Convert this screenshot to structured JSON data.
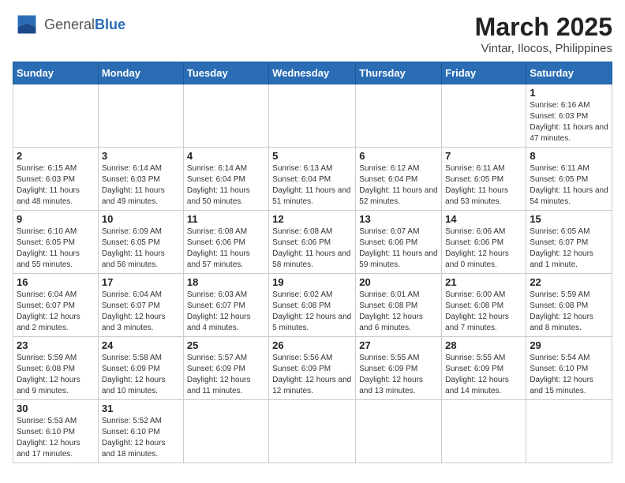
{
  "header": {
    "logo_general": "General",
    "logo_blue": "Blue",
    "month": "March 2025",
    "location": "Vintar, Ilocos, Philippines"
  },
  "weekdays": [
    "Sunday",
    "Monday",
    "Tuesday",
    "Wednesday",
    "Thursday",
    "Friday",
    "Saturday"
  ],
  "weeks": [
    [
      {
        "day": "",
        "info": ""
      },
      {
        "day": "",
        "info": ""
      },
      {
        "day": "",
        "info": ""
      },
      {
        "day": "",
        "info": ""
      },
      {
        "day": "",
        "info": ""
      },
      {
        "day": "",
        "info": ""
      },
      {
        "day": "1",
        "info": "Sunrise: 6:16 AM\nSunset: 6:03 PM\nDaylight: 11 hours and 47 minutes."
      }
    ],
    [
      {
        "day": "2",
        "info": "Sunrise: 6:15 AM\nSunset: 6:03 PM\nDaylight: 11 hours and 48 minutes."
      },
      {
        "day": "3",
        "info": "Sunrise: 6:14 AM\nSunset: 6:03 PM\nDaylight: 11 hours and 49 minutes."
      },
      {
        "day": "4",
        "info": "Sunrise: 6:14 AM\nSunset: 6:04 PM\nDaylight: 11 hours and 50 minutes."
      },
      {
        "day": "5",
        "info": "Sunrise: 6:13 AM\nSunset: 6:04 PM\nDaylight: 11 hours and 51 minutes."
      },
      {
        "day": "6",
        "info": "Sunrise: 6:12 AM\nSunset: 6:04 PM\nDaylight: 11 hours and 52 minutes."
      },
      {
        "day": "7",
        "info": "Sunrise: 6:11 AM\nSunset: 6:05 PM\nDaylight: 11 hours and 53 minutes."
      },
      {
        "day": "8",
        "info": "Sunrise: 6:11 AM\nSunset: 6:05 PM\nDaylight: 11 hours and 54 minutes."
      }
    ],
    [
      {
        "day": "9",
        "info": "Sunrise: 6:10 AM\nSunset: 6:05 PM\nDaylight: 11 hours and 55 minutes."
      },
      {
        "day": "10",
        "info": "Sunrise: 6:09 AM\nSunset: 6:05 PM\nDaylight: 11 hours and 56 minutes."
      },
      {
        "day": "11",
        "info": "Sunrise: 6:08 AM\nSunset: 6:06 PM\nDaylight: 11 hours and 57 minutes."
      },
      {
        "day": "12",
        "info": "Sunrise: 6:08 AM\nSunset: 6:06 PM\nDaylight: 11 hours and 58 minutes."
      },
      {
        "day": "13",
        "info": "Sunrise: 6:07 AM\nSunset: 6:06 PM\nDaylight: 11 hours and 59 minutes."
      },
      {
        "day": "14",
        "info": "Sunrise: 6:06 AM\nSunset: 6:06 PM\nDaylight: 12 hours and 0 minutes."
      },
      {
        "day": "15",
        "info": "Sunrise: 6:05 AM\nSunset: 6:07 PM\nDaylight: 12 hours and 1 minute."
      }
    ],
    [
      {
        "day": "16",
        "info": "Sunrise: 6:04 AM\nSunset: 6:07 PM\nDaylight: 12 hours and 2 minutes."
      },
      {
        "day": "17",
        "info": "Sunrise: 6:04 AM\nSunset: 6:07 PM\nDaylight: 12 hours and 3 minutes."
      },
      {
        "day": "18",
        "info": "Sunrise: 6:03 AM\nSunset: 6:07 PM\nDaylight: 12 hours and 4 minutes."
      },
      {
        "day": "19",
        "info": "Sunrise: 6:02 AM\nSunset: 6:08 PM\nDaylight: 12 hours and 5 minutes."
      },
      {
        "day": "20",
        "info": "Sunrise: 6:01 AM\nSunset: 6:08 PM\nDaylight: 12 hours and 6 minutes."
      },
      {
        "day": "21",
        "info": "Sunrise: 6:00 AM\nSunset: 6:08 PM\nDaylight: 12 hours and 7 minutes."
      },
      {
        "day": "22",
        "info": "Sunrise: 5:59 AM\nSunset: 6:08 PM\nDaylight: 12 hours and 8 minutes."
      }
    ],
    [
      {
        "day": "23",
        "info": "Sunrise: 5:59 AM\nSunset: 6:08 PM\nDaylight: 12 hours and 9 minutes."
      },
      {
        "day": "24",
        "info": "Sunrise: 5:58 AM\nSunset: 6:09 PM\nDaylight: 12 hours and 10 minutes."
      },
      {
        "day": "25",
        "info": "Sunrise: 5:57 AM\nSunset: 6:09 PM\nDaylight: 12 hours and 11 minutes."
      },
      {
        "day": "26",
        "info": "Sunrise: 5:56 AM\nSunset: 6:09 PM\nDaylight: 12 hours and 12 minutes."
      },
      {
        "day": "27",
        "info": "Sunrise: 5:55 AM\nSunset: 6:09 PM\nDaylight: 12 hours and 13 minutes."
      },
      {
        "day": "28",
        "info": "Sunrise: 5:55 AM\nSunset: 6:09 PM\nDaylight: 12 hours and 14 minutes."
      },
      {
        "day": "29",
        "info": "Sunrise: 5:54 AM\nSunset: 6:10 PM\nDaylight: 12 hours and 15 minutes."
      }
    ],
    [
      {
        "day": "30",
        "info": "Sunrise: 5:53 AM\nSunset: 6:10 PM\nDaylight: 12 hours and 17 minutes."
      },
      {
        "day": "31",
        "info": "Sunrise: 5:52 AM\nSunset: 6:10 PM\nDaylight: 12 hours and 18 minutes."
      },
      {
        "day": "",
        "info": ""
      },
      {
        "day": "",
        "info": ""
      },
      {
        "day": "",
        "info": ""
      },
      {
        "day": "",
        "info": ""
      },
      {
        "day": "",
        "info": ""
      }
    ]
  ]
}
